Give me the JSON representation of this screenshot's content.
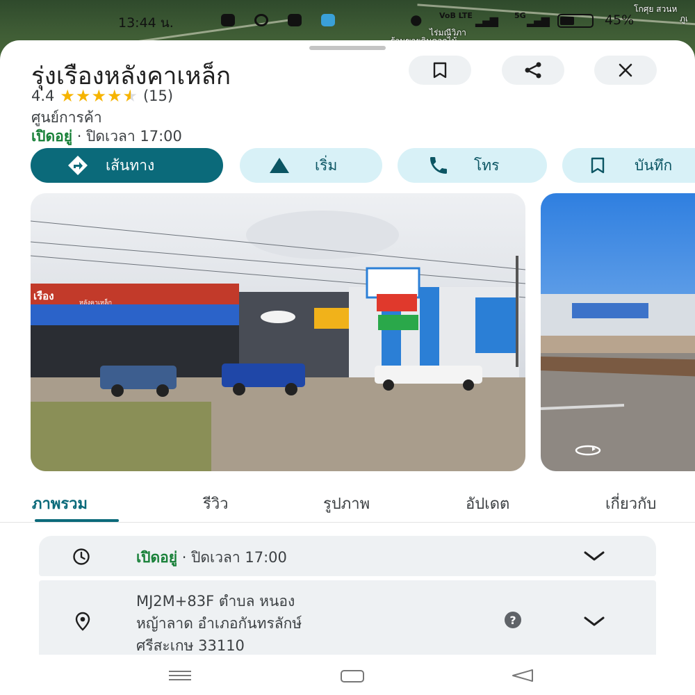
{
  "status_bar": {
    "time": "13:44 น.",
    "battery": "45%",
    "sim1": "VoB LTE",
    "sim2": "5G"
  },
  "map": {
    "label_top_right": "โกศุย สวนห",
    "label_right": "ภูเ",
    "label_center_1": "ไร่มณีวิภา",
    "label_center_2": "ร้านขายดินดอกไม้"
  },
  "place": {
    "name": "รุ่งเรืองหลังคาเหล็ก",
    "rating": "4.4",
    "rating_value": 4.4,
    "review_count": "(15)",
    "category": "ศูนย์การค้า",
    "open_status": "เปิดอยู่",
    "close_info": " · ปิดเวลา 17:00"
  },
  "actions": {
    "directions": "เส้นทาง",
    "start": "เริ่ม",
    "call": "โทร",
    "save": "บันทึก"
  },
  "tabs": [
    "ภาพรวม",
    "รีวิว",
    "รูปภาพ",
    "อัปเดต",
    "เกี่ยวกับ"
  ],
  "details": {
    "hours_status": "เปิดอยู่",
    "hours_text": " · ปิดเวลา 17:00",
    "address_line1": "MJ2M+83F ตำบล หนอง",
    "address_line2": "หญ้าลาด อำเภอกันทรลักษ์",
    "address_line3": "ศรีสะเกษ 33110"
  },
  "photo": {
    "sign_text": "เรือง",
    "sign_subtext": "หลังคาเหล็ก"
  },
  "colors": {
    "accent": "#0b6a7a",
    "chip_bg": "#d8f1f7",
    "open_green": "#188038",
    "star": "#f6b400"
  },
  "icons": [
    "bookmark-icon",
    "share-icon",
    "close-icon",
    "directions-icon",
    "navigation-icon",
    "phone-icon",
    "clock-icon",
    "location-pin-icon",
    "help-icon",
    "chevron-down-icon",
    "street-view-icon"
  ]
}
